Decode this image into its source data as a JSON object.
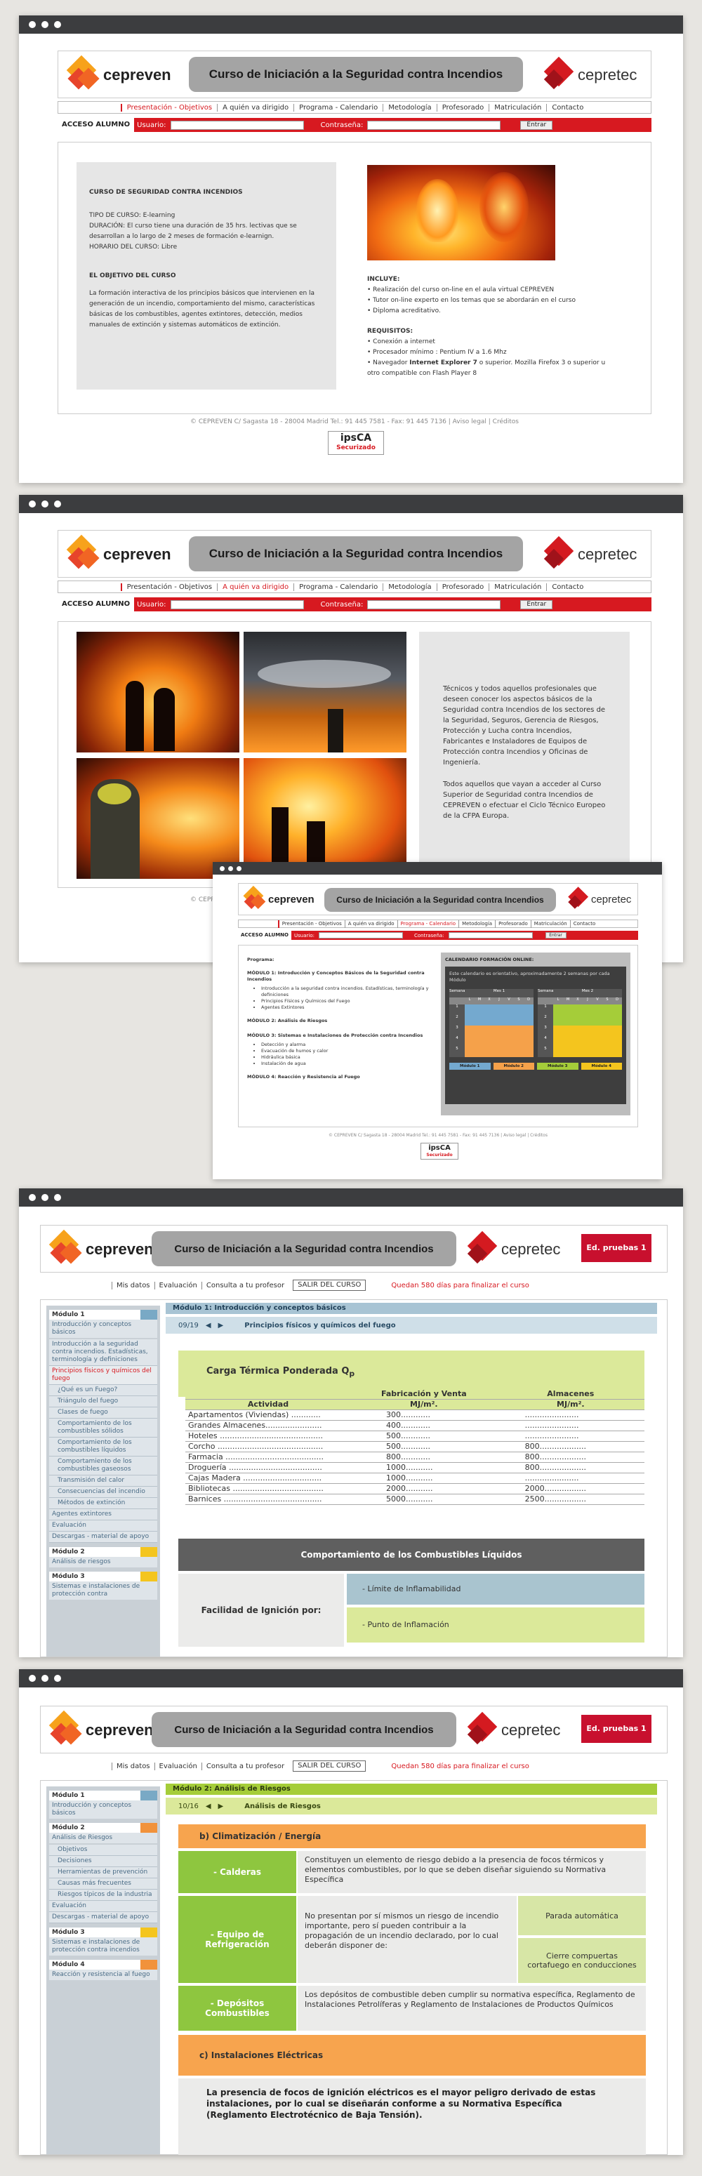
{
  "brand": {
    "left": "cepreven",
    "right": "cepretec",
    "title": "Curso de Iniciación a la Seguridad contra Incendios"
  },
  "nav": [
    "Presentación - Objetivos",
    "A quién va dirigido",
    "Programa - Calendario",
    "Metodología",
    "Profesorado",
    "Matriculación",
    "Contacto"
  ],
  "login": {
    "label": "ACCESO ALUMNO",
    "user": "Usuario:",
    "pass": "Contraseña:",
    "enter": "Entrar"
  },
  "footer": {
    "text": "© CEPREVEN C/ Sagasta 18 - 28004 Madrid Tel.: 91 445 7581 - Fax: 91 445 7136 | Aviso legal | Créditos",
    "ssl_top": "ipsCA",
    "ssl_bottom": "Securizado"
  },
  "w1": {
    "course_heading": "CURSO DE SEGURIDAD CONTRA INCENDIOS",
    "info": [
      "TIPO DE CURSO: E-learning",
      "DURACIÓN: El curso tiene una duración de 35 hrs. lectivas que se desarrollan a lo largo de 2 meses de formación e-learnign.",
      "HORARIO DEL CURSO: Libre"
    ],
    "obj_heading": "EL OBJETIVO DEL CURSO",
    "obj_text": "La formación interactiva de los principios básicos que intervienen en la generación de un incendio, comportamiento del mismo, características básicas de los combustibles, agentes extintores, detección, medios manuales de extinción y sistemas automáticos de extinción.",
    "incl_heading": "INCLUYE:",
    "incl": [
      "• Realización del curso on-line en el aula virtual CEPREVEN",
      "• Tutor on-line experto en los temas que se abordarán en el curso",
      "• Diploma acreditativo."
    ],
    "req_heading": "REQUISITOS:",
    "req": [
      "• Conexión a internet",
      "• Procesador mínimo : Pentium IV a 1.6 Mhz"
    ],
    "req_nav_pre": "• Navegador ",
    "req_nav_bold": "Internet Explorer 7",
    "req_nav_post": " o superior. Mozilla Firefox 3 o superior u otro compatible con Flash Player 8"
  },
  "w2": {
    "p1": "Técnicos y todos aquellos profesionales que deseen conocer los aspectos básicos de la Seguridad contra Incendios de los sectores de la Seguridad, Seguros, Gerencia de Riesgos, Protección y Lucha contra Incendios, Fabricantes e Instaladores de Equipos de Protección contra Incendios y Oficinas de Ingeniería.",
    "p2": "Todos aquellos que vayan a acceder al Curso Superior de Seguridad contra Incendios de CEPREVEN o efectuar el Ciclo Técnico Europeo de la CFPA Europa."
  },
  "w3": {
    "prog_heading": "Programa:",
    "m1": "MÓDULO 1: Introducción y Conceptos Básicos de la Seguridad contra Incendios",
    "m1_items": [
      "Introducción a la seguridad contra incendios. Estadísticas, terminología y definiciones",
      "Principios Físicos y Químicos del Fuego",
      "Agentes Extintores"
    ],
    "m2": "MÓDULO 2: Análisis de Riesgos",
    "m3": "MÓDULO 3: Sistemas e Instalaciones de Protección contra Incendios",
    "m3_items": [
      "Detección y alarma",
      "Evacuación de humos y calor",
      "Hidráulica básica",
      "Instalación de agua"
    ],
    "m4": "MÓDULO 4: Reacción y Resistencia al Fuego",
    "cal_heading": "CALENDARIO FORMACIÓN ONLINE:",
    "cal_text": "Este calendario es orientativo, aproximadamente 2 semanas por cada Módulo",
    "cal_hdr1": "Semana",
    "cal_mes1": "Mes 1",
    "cal_mes2": "Mes 2",
    "weeks": [
      "1",
      "2",
      "3",
      "4",
      "5"
    ],
    "days": [
      "L",
      "M",
      "X",
      "J",
      "V",
      "S",
      "D"
    ],
    "mods": [
      "Módulo 1",
      "Módulo 2",
      "Módulo 3",
      "Módulo 4"
    ]
  },
  "course": {
    "nav": [
      "Mis datos",
      "Evaluación",
      "Consulta a tu profesor"
    ],
    "exit": "SALIR DEL CURSO",
    "remaining": "Quedan 580 días para finalizar el curso",
    "badge": "Ed. pruebas 1"
  },
  "w4": {
    "side": {
      "m1": "Módulo 1",
      "m1s": "Introducción y conceptos básicos",
      "subs": [
        "Introducción a la seguridad contra incendios. Estadísticas, terminología y definiciones",
        "Principios físicos y químicos del fuego",
        "¿Qué es un Fuego?",
        "Triángulo del fuego",
        "Clases de fuego",
        "Comportamiento de los combustibles sólidos",
        "Comportamiento de los combustibles líquidos",
        "Comportamiento de los combustibles gaseosos",
        "Transmisión del calor",
        "Consecuencias del incendio",
        "Métodos de extinción",
        "Agentes extintores",
        "Evaluación",
        "Descargas - material de apoyo"
      ],
      "m2": "Módulo 2",
      "m2s": "Análisis de riesgos",
      "m3": "Módulo 3",
      "m3s": "Sistemas e instalaciones de protección contra"
    },
    "top": "Módulo 1: Introducción y conceptos básicos",
    "page": "09/19",
    "section": "Principios físicos y químicos del fuego",
    "card_title": "Carga Térmica Ponderada Q",
    "card_sub": "p",
    "col_fab": "Fabricación y Venta",
    "col_alm": "Almacenes",
    "col_act": "Actividad",
    "unit": "MJ/m².",
    "rows": [
      [
        "Apartamentos (Viviendas) ............",
        "300............",
        "......................"
      ],
      [
        "Grandes Almacenes.......................",
        "400............",
        "......................"
      ],
      [
        "Hoteles ..........................................",
        "500............",
        "......................"
      ],
      [
        "Corcho ...........................................",
        "500............",
        "800..................."
      ],
      [
        "Farmacia ........................................",
        "800............",
        "800..................."
      ],
      [
        "Droguería ......................................",
        "1000...........",
        "800..................."
      ],
      [
        "Cajas Madera ................................",
        "1000...........",
        "......................"
      ],
      [
        "Bibliotecas .....................................",
        "2000...........",
        "2000................."
      ],
      [
        "Barnices ........................................",
        "5000...........",
        "2500................."
      ]
    ],
    "liq_title": "Comportamiento de los Combustibles Líquidos",
    "ign": "Facilidad de Ignición por:",
    "ign1": "- Límite de Inflamabilidad",
    "ign2": "- Punto de Inflamación"
  },
  "w5": {
    "side": {
      "m1": "Módulo 1",
      "m1s": "Introducción y conceptos básicos",
      "m2": "Módulo 2",
      "m2s": "Análisis de Riesgos",
      "subs": [
        "Objetivos",
        "Decisiones",
        "Herramientas de prevención",
        "Causas más frecuentes",
        "Riesgos típicos de la industria",
        "Evaluación",
        "Descargas - material de apoyo"
      ],
      "m3": "Módulo 3",
      "m3s": "Sistemas e instalaciones de protección contra incendios",
      "m4": "Módulo 4",
      "m4s": "Reacción y resistencia al fuego"
    },
    "top": "Módulo 2: Análisis de Riesgos",
    "page": "10/16",
    "section": "Análisis de Riesgos",
    "b_title": "b) Climatización / Energía",
    "cal": "- Calderas",
    "cal_txt": "Constituyen un elemento de riesgo debido a la presencia de focos térmicos y elementos combustibles, por lo que se deben diseñar siguiendo su Normativa Específica",
    "eq": "- Equipo de Refrigeración",
    "eq_txt": "No presentan por sí mismos un riesgo de incendio importante, pero sí pueden contribuir a la propagación de un incendio declarado, por lo cual deberán disponer de:",
    "eq_a": "Parada automática",
    "eq_b": "Cierre compuertas cortafuego en conducciones",
    "dep": "- Depósitos Combustibles",
    "dep_txt": "Los depósitos de combustible deben cumplir su normativa específica, Reglamento de Instalaciones Petrolíferas y Reglamento de Instalaciones de Productos Químicos",
    "c_title": "c) Instalaciones Eléctricas",
    "c_txt": "La presencia de focos de ignición eléctricos es el mayor peligro derivado de estas instalaciones, por lo cual se diseñarán conforme a su Normativa Específica (Reglamento Electrotécnico de Baja Tensión)."
  }
}
